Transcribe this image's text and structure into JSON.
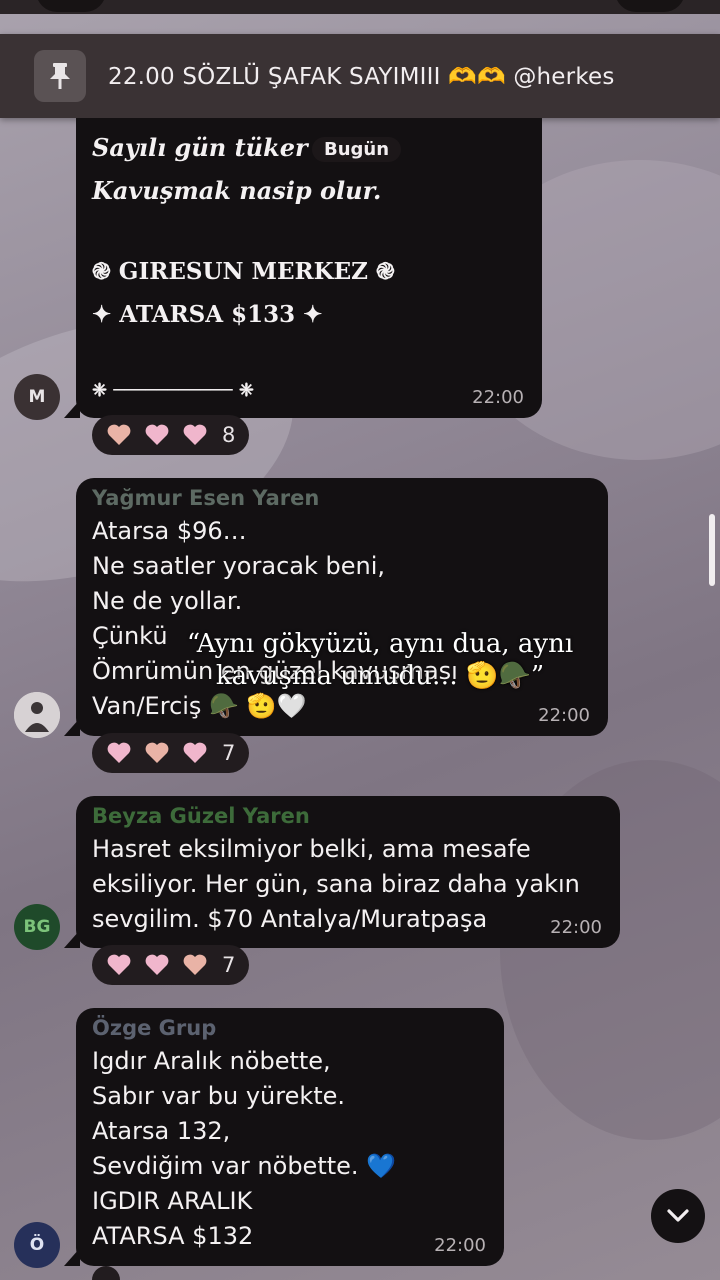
{
  "pinned": {
    "text": "22.00 SÖZLÜ ŞAFAK SAYIMIII 🫶🫶 @herkes",
    "icon": "pin-icon"
  },
  "date_pill": "Bugün",
  "overlay_caption": {
    "line1": "“Aynı gökyüzü, aynı dua, aynı",
    "line2": "kavuşma umudu… 🫡🪖”"
  },
  "messages": [
    {
      "avatar": "M",
      "avatar_color": "#3a3133",
      "lines": [
        "Sayılı gün tüker ",
        "Kavuşmak nasip olur."
      ],
      "line3": "֎ GIRESUN MERKEZ ֎",
      "line4": "✦ ATARSA $133 ✦",
      "divider": "❈ ─────────── ❈",
      "time": "22:00",
      "reaction_count": "8"
    },
    {
      "sender": "Yağmur Esen Yaren",
      "sender_color": "#5d6a63",
      "lines": [
        "Atarsa $96…",
        "Ne saatler yoracak beni,",
        "Ne de yollar.",
        "Çünkü ",
        "Ömrümün en güzel kavuşması ",
        "Van/Erciş 🪖 🫡🤍"
      ],
      "time": "22:00",
      "reaction_count": "7"
    },
    {
      "avatar": "BG",
      "avatar_color": "#1f4a2a",
      "sender": "Beyza Güzel Yaren",
      "sender_color": "#3d6b3a",
      "lines": [
        "Hasret eksilmiyor belki, ama mesafe",
        "eksiliyor. Her gün, sana biraz daha yakın",
        "sevgilim. $70 Antalya/Muratpaşa"
      ],
      "time": "22:00",
      "reaction_count": "7"
    },
    {
      "avatar": "Ö",
      "avatar_color": "#26305a",
      "sender": "Özge Grup",
      "sender_color": "#5c6270",
      "lines": [
        "Igdır Aralık nöbette,",
        "Sabır var bu yürekte.",
        "Atarsa 132,",
        "Sevdiğim var nöbette. 💙",
        "IGDIR ARALIK",
        "ATARSA $132"
      ],
      "time": "22:00"
    }
  ],
  "colors": {
    "bubble": "#131012",
    "heart_pink": "#f0b6cc",
    "heart_peach": "#e9b3a6"
  }
}
